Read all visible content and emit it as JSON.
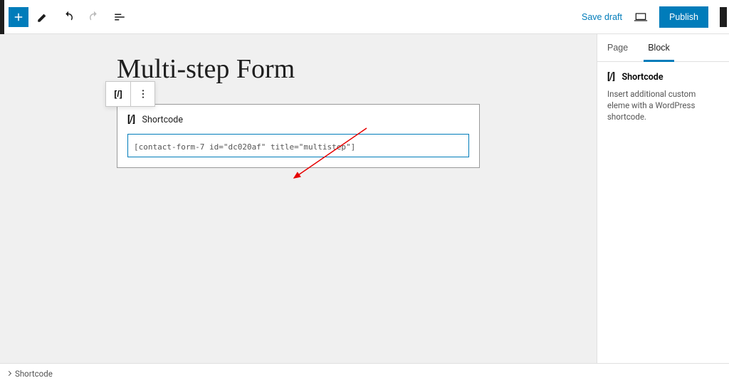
{
  "toolbar": {
    "save_draft": "Save draft",
    "publish": "Publish"
  },
  "page": {
    "title": "Multi-step Form"
  },
  "block": {
    "name": "Shortcode",
    "value": "[contact-form-7 id=\"dc020af\" title=\"multistep\"]"
  },
  "sidebar": {
    "tabs": {
      "page": "Page",
      "block": "Block"
    },
    "panel": {
      "title": "Shortcode",
      "desc": "Insert additional custom eleme with a WordPress shortcode."
    }
  },
  "breadcrumb": {
    "item": "Shortcode"
  },
  "icons": {
    "shortcode_glyph": "[/]"
  }
}
